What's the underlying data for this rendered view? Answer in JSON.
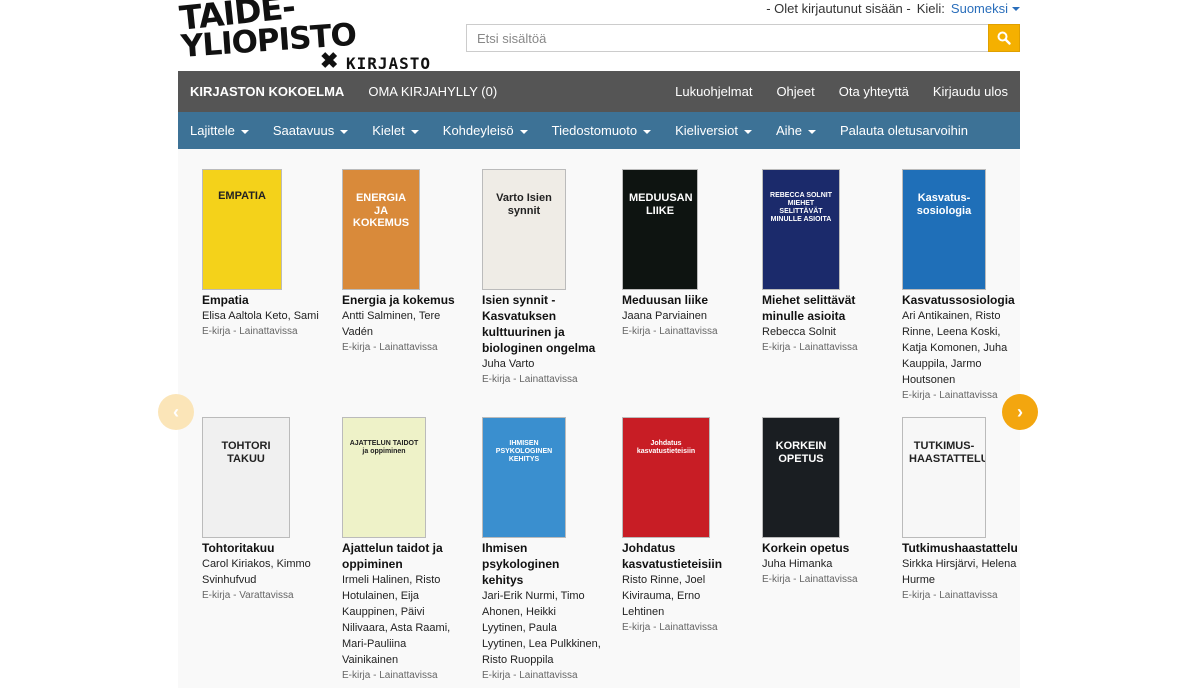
{
  "logo": {
    "line1": "TAIDE-",
    "line2": "YLIOPISTO",
    "library": "KIRJASTO"
  },
  "topbar": {
    "login_status": "- Olet kirjautunut sisään -",
    "lang_label": "Kieli:",
    "lang_value": "Suomeksi"
  },
  "search": {
    "placeholder": "Etsi sisältöä"
  },
  "mainnav": {
    "left": [
      "KIRJASTON KOKOELMA",
      "OMA KIRJAHYLLY (0)"
    ],
    "right": [
      "Lukuohjelmat",
      "Ohjeet",
      "Ota yhteyttä",
      "Kirjaudu ulos"
    ]
  },
  "filters": [
    "Lajittele",
    "Saatavuus",
    "Kielet",
    "Kohdeyleisö",
    "Tiedostomuoto",
    "Kieliversiot",
    "Aihe"
  ],
  "reset_label": "Palauta oletusarvoihin",
  "books": [
    {
      "title": "Empatia",
      "authors": "Elisa Aaltola Keto, Sami",
      "status": "E-kirja - Lainattavissa",
      "cover_color": "#f4d21a",
      "cover_text": "EMPATIA"
    },
    {
      "title": "Energia ja kokemus",
      "authors": "Antti Salminen, Tere Vadén",
      "status": "E-kirja - Lainattavissa",
      "cover_color": "#d98a3a",
      "cover_text": "ENERGIA JA KOKEMUS"
    },
    {
      "title": "Isien synnit -Kasvatuksen kulttuurinen ja biologinen ongelma",
      "authors": "Juha Varto",
      "status": "E-kirja - Lainattavissa",
      "cover_color": "#efece6",
      "cover_text": "Varto Isien synnit"
    },
    {
      "title": "Meduusan liike",
      "authors": "Jaana Parviainen",
      "status": "E-kirja - Lainattavissa",
      "cover_color": "#0e1411",
      "cover_text": "MEDUUSAN LIIKE"
    },
    {
      "title": "Miehet selittävät minulle asioita",
      "authors": "Rebecca Solnit",
      "status": "E-kirja - Lainattavissa",
      "cover_color": "#1b2a6b",
      "cover_text": "REBECCA SOLNIT MIEHET SELITTÄVÄT MINULLE ASIOITA"
    },
    {
      "title": "Kasvatussosiologia",
      "authors": "Ari Antikainen, Risto Rinne, Leena Koski, Katja Komonen, Juha Kauppila, Jarmo Houtsonen",
      "status": "E-kirja - Lainattavissa",
      "cover_color": "#1f6fb8",
      "cover_text": "Kasvatus-sosiologia"
    },
    {
      "title": "Tohtoritakuu",
      "authors": "Carol Kiriakos, Kimmo Svinhufvud",
      "status": "E-kirja - Varattavissa",
      "cover_color": "#f0f0f0",
      "cover_text": "TOHTORI TAKUU"
    },
    {
      "title": "Ajattelun taidot ja oppiminen",
      "authors": "Irmeli Halinen, Risto Hotulainen, Eija Kauppinen, Päivi Nilivaara, Asta Raami, Mari-Pauliina Vainikainen",
      "status": "E-kirja - Lainattavissa",
      "cover_color": "#eef2c8",
      "cover_text": "AJATTELUN TAIDOT ja oppiminen"
    },
    {
      "title": "Ihmisen psykologinen kehitys",
      "authors": "Jari-Erik Nurmi, Timo Ahonen, Heikki Lyytinen, Paula Lyytinen, Lea Pulkkinen, Risto Ruoppila",
      "status": "E-kirja - Lainattavissa",
      "cover_color": "#3a8fcf",
      "cover_text": "IHMISEN PSYKOLOGINEN KEHITYS"
    },
    {
      "title": "Johdatus kasvatustieteisiin",
      "authors": "Risto Rinne, Joel Kivirauma, Erno Lehtinen",
      "status": "E-kirja - Lainattavissa",
      "cover_color": "#c81d25",
      "cover_text": "Johdatus kasvatustieteisiin"
    },
    {
      "title": "Korkein opetus",
      "authors": "Juha Himanka",
      "status": "E-kirja - Lainattavissa",
      "cover_color": "#1a1e22",
      "cover_text": "KORKEIN OPETUS"
    },
    {
      "title": "Tutkimushaastattelu",
      "authors": "Sirkka Hirsjärvi, Helena Hurme",
      "status": "E-kirja - Lainattavissa",
      "cover_color": "#f7f7f7",
      "cover_text": "TUTKIMUS-HAASTATTELU"
    }
  ]
}
